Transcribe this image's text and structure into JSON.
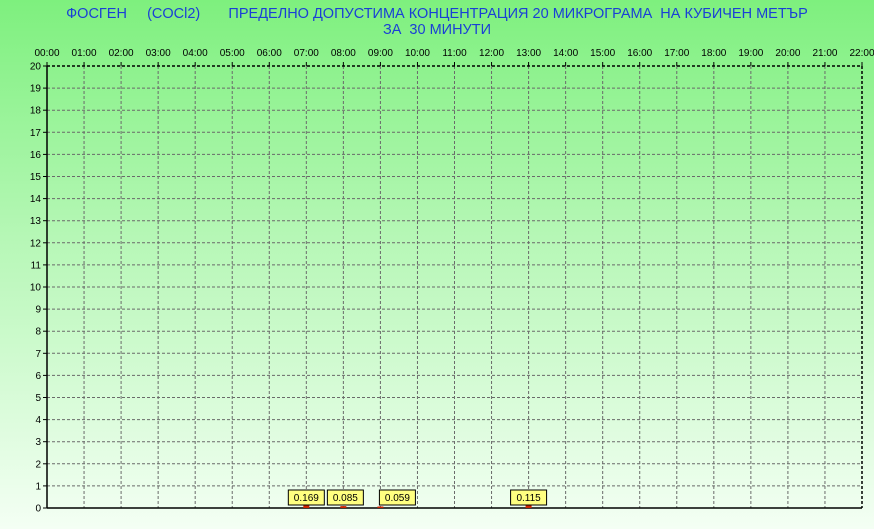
{
  "chart_data": {
    "type": "bar",
    "title": "ФОСГЕН     (COCl2)       ПРЕДЕЛНО ДОПУСТИМА КОНЦЕНТРАЦИЯ 20 МИКРОГРАМА  НА КУБИЧЕН МЕТЪР",
    "subtitle": "ЗА  30 МИНУТИ",
    "xlabel": "",
    "ylabel": "",
    "x_ticks": [
      "00:00",
      "01:00",
      "02:00",
      "03:00",
      "04:00",
      "05:00",
      "06:00",
      "07:00",
      "08:00",
      "09:00",
      "10:00",
      "11:00",
      "12:00",
      "13:00",
      "14:00",
      "15:00",
      "16:00",
      "17:00",
      "18:00",
      "19:00",
      "20:00",
      "21:00",
      "22:00"
    ],
    "y_ticks": [
      0,
      1,
      2,
      3,
      4,
      5,
      6,
      7,
      8,
      9,
      10,
      11,
      12,
      13,
      14,
      15,
      16,
      17,
      18,
      19,
      20
    ],
    "ylim": [
      0,
      20
    ],
    "grid": true,
    "bar_color": "#cc2200",
    "label_bg": "#ffff80",
    "points": [
      {
        "time": "07:00",
        "value": 0.169,
        "label": "0.169"
      },
      {
        "time": "08:00",
        "value": 0.085,
        "label": "0.085"
      },
      {
        "time": "09:00",
        "value": 0.059,
        "label": "0.059"
      },
      {
        "time": "13:00",
        "value": 0.115,
        "label": "0.115"
      }
    ]
  }
}
